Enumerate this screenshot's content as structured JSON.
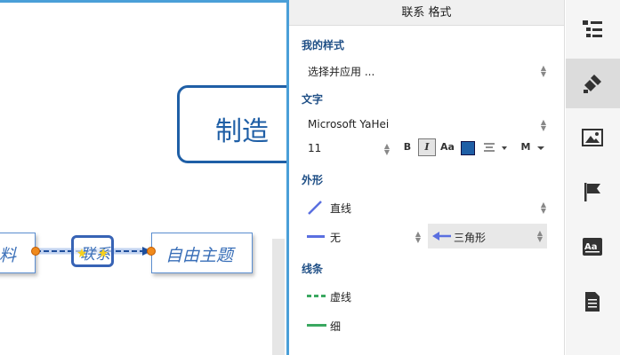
{
  "canvas": {
    "main_topic": "制造",
    "left_topic": "料",
    "free_topic": "自由主题",
    "relation_label": "联系"
  },
  "panel": {
    "title": "联系 格式",
    "my_style": {
      "heading": "我的样式",
      "value": "选择并应用 ..."
    },
    "text": {
      "heading": "文字",
      "font": "Microsoft YaHei",
      "size": "11",
      "bold": "B",
      "italic": "I",
      "case": "Aa",
      "color": "#1f5fa6",
      "align_icon": "align-center-icon",
      "more": "M"
    },
    "shape": {
      "heading": "外形",
      "line_type": "直线",
      "start_arrow": "无",
      "end_arrow": "三角形"
    },
    "line": {
      "heading": "线条",
      "style": "虚线",
      "width": "细"
    }
  },
  "sidebar": {
    "items": [
      {
        "icon": "outline-icon"
      },
      {
        "icon": "format-brush-icon",
        "active": true
      },
      {
        "icon": "image-icon"
      },
      {
        "icon": "flag-icon"
      },
      {
        "icon": "text-style-icon"
      },
      {
        "icon": "document-icon"
      }
    ]
  },
  "colors": {
    "accent": "#4a9fd8",
    "topic_blue": "#1f5fa6",
    "relation_blue": "#3763b5",
    "line_green": "#3aa860",
    "shape_blue": "#5a6fe0"
  }
}
